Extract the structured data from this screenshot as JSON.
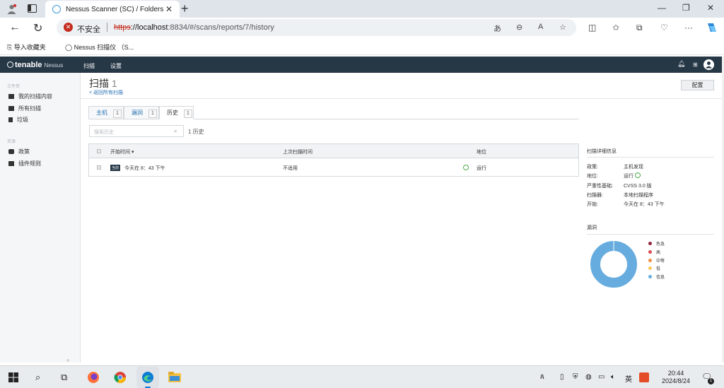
{
  "browser": {
    "tab_title": "Nessus Scanner (SC) / Folders / V",
    "insecure_label": "不安全",
    "url_scheme": "https",
    "url_host": "://localhost",
    "url_rest": ":8834/#/scans/reports/7/history",
    "favorites": [
      "导入收藏夹",
      "Nessus 扫描仪 （S..."
    ]
  },
  "app": {
    "logo": "tenable",
    "logo_sub": "Nessus",
    "nav": [
      "扫描",
      "设置"
    ]
  },
  "sidebar": {
    "section1": "文件夹",
    "items1": [
      "我的扫描内容",
      "所有扫描",
      "垃圾"
    ],
    "section2": "资源",
    "items2": [
      "政策",
      "插件规则"
    ],
    "collapse": "«"
  },
  "page": {
    "title": "扫描",
    "title_num": "1",
    "back_link": "< 返回所有扫描",
    "config_button": "配置"
  },
  "tabs": [
    {
      "label": "主机",
      "count": "1"
    },
    {
      "label": "漏洞",
      "count": "1"
    },
    {
      "label": "历史",
      "count": "1"
    }
  ],
  "search": {
    "placeholder": "搜索历史",
    "count": "1 历史"
  },
  "table": {
    "headers": [
      "开始时间",
      "上次扫描时间",
      "地位"
    ],
    "sort_indicator": "▾",
    "row": {
      "badge": "当前",
      "start": "今天在 8：43 下午",
      "last": "不适用",
      "status": "运行"
    }
  },
  "details": {
    "title": "扫描详细信息",
    "rows": [
      {
        "label": "政策:",
        "value": "主机发现"
      },
      {
        "label": "地位:",
        "value": "运行"
      },
      {
        "label": "严重性基础:",
        "value": "CVSS 3.0 版"
      },
      {
        "label": "扫描器:",
        "value": "本地扫描程序"
      },
      {
        "label": "开始:",
        "value": "今天在 8：43 下午"
      }
    ]
  },
  "vulnerabilities": {
    "title": "漏洞",
    "legend": [
      {
        "label": "危急",
        "color": "#91243e"
      },
      {
        "label": "高",
        "color": "#dd4b50"
      },
      {
        "label": "中等",
        "color": "#f18c43"
      },
      {
        "label": "低",
        "color": "#f8c851"
      },
      {
        "label": "信息",
        "color": "#67acdf"
      }
    ]
  },
  "taskbar": {
    "ime": "英",
    "time": "20:44",
    "date": "2024/8/24",
    "notify": "1"
  }
}
